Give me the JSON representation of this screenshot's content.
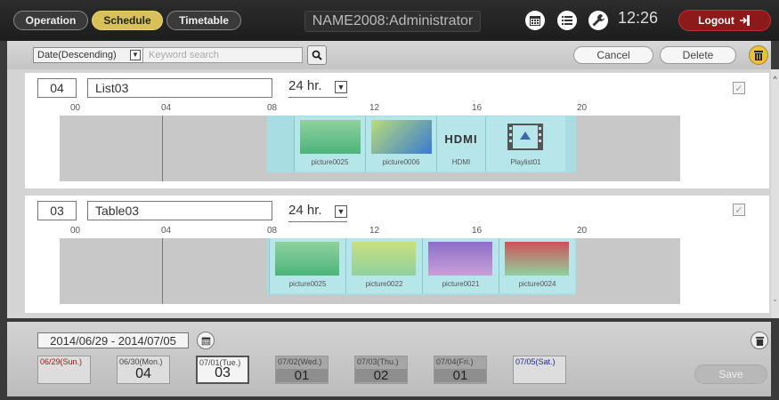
{
  "header": {
    "tabs": [
      {
        "label": "Operation",
        "active": false
      },
      {
        "label": "Schedule",
        "active": true
      },
      {
        "label": "Timetable",
        "active": false
      }
    ],
    "title": "NAME2008:Administrator",
    "clock": "12:26",
    "logout_label": "Logout",
    "icons": [
      "calendar-icon",
      "list-icon",
      "wrench-icon"
    ]
  },
  "toolbar": {
    "sort_value": "Date(Descending)",
    "search_placeholder": "Keyword search",
    "cancel_label": "Cancel",
    "delete_label": "Delete"
  },
  "hour_labels": [
    "00",
    "04",
    "08",
    "12",
    "16",
    "20"
  ],
  "schedules": [
    {
      "number": "04",
      "name": "List03",
      "hours": "24 hr.",
      "items": [
        {
          "label": "picture0025",
          "kind": "picture",
          "color": "#5dbf86"
        },
        {
          "label": "picture0006",
          "kind": "picture",
          "color": "#5a9ad0"
        },
        {
          "label": "HDMI",
          "kind": "hdmi"
        },
        {
          "label": "Playlist01",
          "kind": "playlist"
        }
      ]
    },
    {
      "number": "03",
      "name": "Table03",
      "hours": "24 hr.",
      "items": [
        {
          "label": "picture0025",
          "kind": "picture",
          "color": "#4cb47a"
        },
        {
          "label": "picture0022",
          "kind": "picture",
          "color": "#b7dd7a"
        },
        {
          "label": "picture0021",
          "kind": "picture",
          "color": "#8d6fc9"
        },
        {
          "label": "picture0024",
          "kind": "picture",
          "color": "#d0505a"
        }
      ]
    }
  ],
  "week": {
    "range": "2014/06/29 - 2014/07/05",
    "days": [
      {
        "label": "06/29(Sun.)",
        "value": "",
        "color": "#a01818"
      },
      {
        "label": "06/30(Mon.)",
        "value": "04",
        "color": "#444"
      },
      {
        "label": "07/01(Tue.)",
        "value": "03",
        "color": "#444"
      },
      {
        "label": "07/02(Wed.)",
        "value": "01",
        "color": "#444"
      },
      {
        "label": "07/03(Thu.)",
        "value": "02",
        "color": "#444"
      },
      {
        "label": "07/04(Fri.)",
        "value": "01",
        "color": "#444"
      },
      {
        "label": "07/05(Sat.)",
        "value": "",
        "color": "#1c2a8a"
      }
    ],
    "save_label": "Save"
  }
}
